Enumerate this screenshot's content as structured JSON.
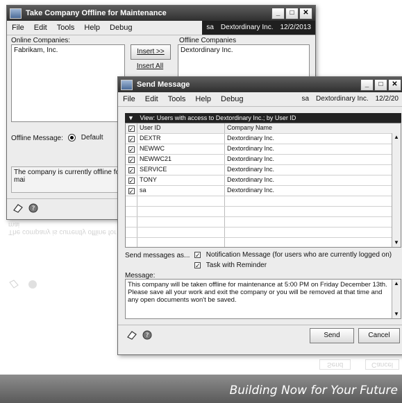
{
  "back_window": {
    "title": "Take Company Offline for Maintenance",
    "menu": [
      "File",
      "Edit",
      "Tools",
      "Help",
      "Debug"
    ],
    "user": "sa",
    "company": "Dextordinary Inc.",
    "date": "12/2/2013",
    "online_label": "Online Companies:",
    "online_companies": [
      "Fabrikam, Inc."
    ],
    "offline_label": "Offline Companies",
    "offline_companies": [
      "Dextordinary Inc."
    ],
    "insert_label": "Insert >>",
    "insert_all_label": "Insert All",
    "offline_message_label": "Offline Message:",
    "default_label": "Default",
    "message_text": "The company is currently offline for mai"
  },
  "front_window": {
    "title": "Send Message",
    "menu": [
      "File",
      "Edit",
      "Tools",
      "Help",
      "Debug"
    ],
    "user": "sa",
    "company": "Dextordinary Inc.",
    "date": "12/2/20",
    "grid_view": "View: Users with access to Dextordinary Inc.; by User ID",
    "columns": [
      "User ID",
      "Company Name"
    ],
    "rows": [
      {
        "user_id": "DEXTR",
        "company": "Dextordinary Inc."
      },
      {
        "user_id": "NEWWC",
        "company": "Dextordinary Inc."
      },
      {
        "user_id": "NEWWC21",
        "company": "Dextordinary Inc."
      },
      {
        "user_id": "SERVICE",
        "company": "Dextordinary Inc."
      },
      {
        "user_id": "TONY",
        "company": "Dextordinary Inc."
      },
      {
        "user_id": "sa",
        "company": "Dextordinary Inc."
      }
    ],
    "send_as_label": "Send messages as...",
    "opt_notification": "Notification Message (for users who are currently logged on)",
    "opt_task": "Task with Reminder",
    "message_label": "Message:",
    "message_body": "This company will be taken offline for maintenance at 5:00 PM on Friday December 13th. Please save all your work and exit the company or you will be removed at that time and any open documents won't be saved.",
    "send_label": "Send",
    "cancel_label": "Cancel"
  },
  "banner": {
    "text": "Building Now for Your Future"
  }
}
